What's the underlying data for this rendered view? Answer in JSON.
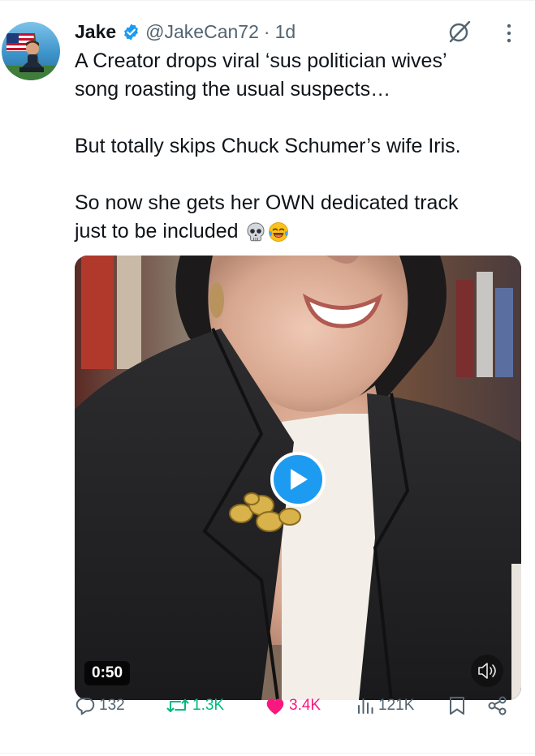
{
  "tweet": {
    "author_name": "Jake",
    "handle": "@JakeCan72",
    "separator": "·",
    "time": "1d",
    "text_lines": [
      "A Creator drops viral ‘sus politician wives’",
      "song roasting the usual suspects…",
      "",
      "But totally skips Chuck Schumer’s wife Iris.",
      "",
      "So now she gets her OWN dedicated track",
      "just to be included"
    ],
    "emojis": [
      "skull-emoji",
      "laughing-crying-emoji"
    ],
    "media": {
      "type": "video",
      "duration": "0:50"
    },
    "stats": {
      "replies": "132",
      "reposts": "1.3K",
      "likes": "3.4K",
      "views": "121K"
    }
  },
  "icons": [
    "verified-badge-icon",
    "grok-icon",
    "more-options-icon",
    "play-icon",
    "volume-muted-icon",
    "reply-icon",
    "repost-icon",
    "like-icon",
    "views-icon",
    "bookmark-icon",
    "share-icon"
  ],
  "colors": {
    "accent": "#1d9bf0",
    "text": "#0f1419",
    "secondary_text": "#536471",
    "repost_active": "#00ba7c",
    "like_active": "#f91880"
  }
}
